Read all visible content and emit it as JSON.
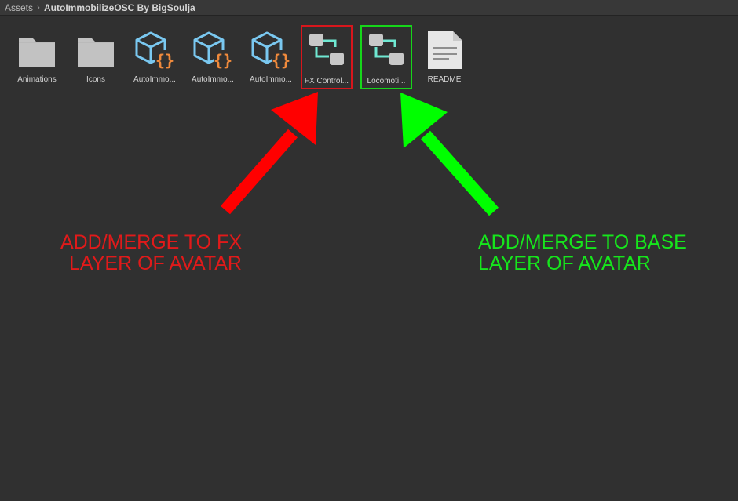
{
  "breadcrumb": {
    "root": "Assets",
    "current": "AutoImmobilizeOSC By BigSoulja"
  },
  "assets": [
    {
      "label": "Animations",
      "icon": "folder-icon"
    },
    {
      "label": "Icons",
      "icon": "folder-icon"
    },
    {
      "label": "AutoImmo...",
      "icon": "script-asset-icon"
    },
    {
      "label": "AutoImmo...",
      "icon": "script-asset-icon"
    },
    {
      "label": "AutoImmo...",
      "icon": "script-asset-icon"
    },
    {
      "label": "FX Control...",
      "icon": "animator-controller-icon"
    },
    {
      "label": "Locomoti...",
      "icon": "animator-controller-icon"
    },
    {
      "label": "README",
      "icon": "text-document-icon"
    }
  ],
  "annotations": {
    "red": {
      "line1": "ADD/MERGE TO FX",
      "line2": "LAYER OF AVATAR",
      "color": "#e11a1a"
    },
    "green": {
      "line1": "ADD/MERGE TO BASE",
      "line2": "LAYER OF AVATAR",
      "color": "#16e61c"
    }
  },
  "colors": {
    "background": "#303030",
    "toolbar": "#383838",
    "folder": "#c2c2c2",
    "cube": "#7ac8f0",
    "braces": "#f08a3c",
    "controller_node": "#c8c8c8",
    "controller_link": "#6fe8d2",
    "highlight_red": "#d8161c",
    "highlight_green": "#16d61a"
  }
}
